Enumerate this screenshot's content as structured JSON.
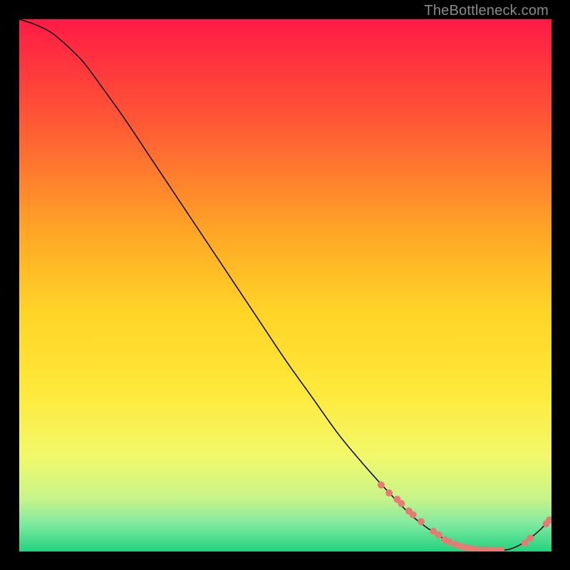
{
  "watermark": "TheBottleneck.com",
  "chart_data": {
    "type": "line",
    "title": "",
    "xlabel": "",
    "ylabel": "",
    "xlim": [
      0,
      100
    ],
    "ylim": [
      0,
      100
    ],
    "grid": false,
    "gradient_stops": [
      {
        "offset": 0.0,
        "color": "#ff1a46"
      },
      {
        "offset": 0.2,
        "color": "#ff5a34"
      },
      {
        "offset": 0.4,
        "color": "#ffa626"
      },
      {
        "offset": 0.55,
        "color": "#ffd427"
      },
      {
        "offset": 0.7,
        "color": "#ffe93a"
      },
      {
        "offset": 0.82,
        "color": "#f2f86a"
      },
      {
        "offset": 0.9,
        "color": "#c8f48a"
      },
      {
        "offset": 0.95,
        "color": "#7de9a0"
      },
      {
        "offset": 1.0,
        "color": "#22d27f"
      }
    ],
    "series": [
      {
        "name": "bottleneck-curve",
        "color": "#000000",
        "x": [
          0,
          3,
          6,
          9,
          12,
          15,
          20,
          25,
          30,
          35,
          40,
          45,
          50,
          55,
          60,
          65,
          70,
          74,
          78,
          81,
          84,
          87,
          90,
          92,
          94,
          96,
          98,
          100
        ],
        "y": [
          100,
          99,
          97.5,
          95,
          92,
          88,
          81,
          73.5,
          66,
          58.5,
          51,
          43.5,
          36,
          29,
          22,
          16,
          10.5,
          6.5,
          3.5,
          1.8,
          0.8,
          0.3,
          0.2,
          0.4,
          1.2,
          2.5,
          4.2,
          6.4
        ]
      }
    ],
    "markers": {
      "name": "model-points",
      "color": "#e77a72",
      "radius_px": 5,
      "points": [
        {
          "x": 68.0,
          "y": 12.5
        },
        {
          "x": 69.5,
          "y": 11.0
        },
        {
          "x": 71.0,
          "y": 9.8
        },
        {
          "x": 71.8,
          "y": 9.0
        },
        {
          "x": 73.2,
          "y": 7.6
        },
        {
          "x": 74.0,
          "y": 6.9
        },
        {
          "x": 75.5,
          "y": 5.6
        },
        {
          "x": 77.8,
          "y": 3.8
        },
        {
          "x": 78.8,
          "y": 3.1
        },
        {
          "x": 80.0,
          "y": 2.2
        },
        {
          "x": 80.8,
          "y": 1.8
        },
        {
          "x": 82.0,
          "y": 1.3
        },
        {
          "x": 83.0,
          "y": 0.95
        },
        {
          "x": 84.0,
          "y": 0.7
        },
        {
          "x": 85.0,
          "y": 0.55
        },
        {
          "x": 86.2,
          "y": 0.4
        },
        {
          "x": 87.5,
          "y": 0.3
        },
        {
          "x": 88.5,
          "y": 0.25
        },
        {
          "x": 89.5,
          "y": 0.22
        },
        {
          "x": 90.5,
          "y": 0.25
        },
        {
          "x": 95.0,
          "y": 1.6
        },
        {
          "x": 96.0,
          "y": 2.5
        },
        {
          "x": 99.0,
          "y": 5.2
        },
        {
          "x": 99.6,
          "y": 5.9
        }
      ]
    }
  }
}
